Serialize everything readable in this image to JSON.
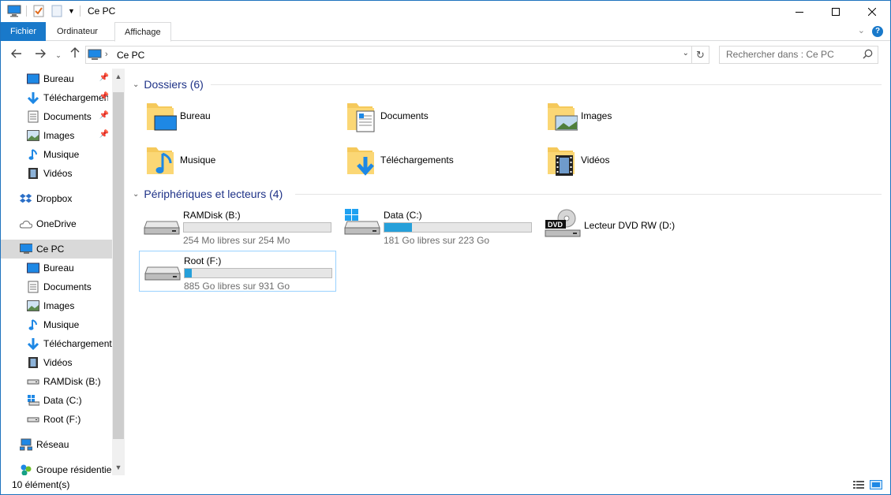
{
  "window": {
    "title": "Ce PC"
  },
  "ribbon": {
    "tabs": [
      "Fichier",
      "Ordinateur",
      "Affichage"
    ],
    "help_label": "?"
  },
  "address": {
    "crumb": "Ce PC",
    "search_placeholder": "Rechercher dans : Ce PC"
  },
  "nav": {
    "quick_access": [
      {
        "label": "Bureau",
        "icon": "desktop-icon",
        "pinned": true
      },
      {
        "label": "Téléchargements",
        "icon": "download-icon",
        "pinned": true
      },
      {
        "label": "Documents",
        "icon": "document-icon",
        "pinned": true
      },
      {
        "label": "Images",
        "icon": "image-icon",
        "pinned": true
      },
      {
        "label": "Musique",
        "icon": "music-icon",
        "pinned": false
      },
      {
        "label": "Vidéos",
        "icon": "video-icon",
        "pinned": false
      }
    ],
    "dropbox": "Dropbox",
    "onedrive": "OneDrive",
    "this_pc": "Ce PC",
    "this_pc_children": [
      {
        "label": "Bureau",
        "icon": "desktop-icon"
      },
      {
        "label": "Documents",
        "icon": "document-icon"
      },
      {
        "label": "Images",
        "icon": "image-icon"
      },
      {
        "label": "Musique",
        "icon": "music-icon"
      },
      {
        "label": "Téléchargements",
        "icon": "download-icon"
      },
      {
        "label": "Vidéos",
        "icon": "video-icon"
      },
      {
        "label": "RAMDisk (B:)",
        "icon": "drive-icon"
      },
      {
        "label": "Data (C:)",
        "icon": "windows-drive-icon"
      },
      {
        "label": "Root (F:)",
        "icon": "drive-icon"
      }
    ],
    "network": "Réseau",
    "homegroup": "Groupe résidentiel"
  },
  "content": {
    "folders_header": "Dossiers (6)",
    "folders": [
      {
        "label": "Bureau",
        "icon": "desktop-folder-icon"
      },
      {
        "label": "Documents",
        "icon": "documents-folder-icon"
      },
      {
        "label": "Images",
        "icon": "pictures-folder-icon"
      },
      {
        "label": "Musique",
        "icon": "music-folder-icon"
      },
      {
        "label": "Téléchargements",
        "icon": "downloads-folder-icon"
      },
      {
        "label": "Vidéos",
        "icon": "videos-folder-icon"
      }
    ],
    "devices_header": "Périphériques et lecteurs (4)",
    "drives": [
      {
        "name": "RAMDisk (B:)",
        "free": "254 Mo libres sur 254 Mo",
        "used_fraction": 0.0,
        "icon": "hdd-icon"
      },
      {
        "name": "Data (C:)",
        "free": "181 Go libres sur 223 Go",
        "used_fraction": 0.19,
        "icon": "windows-hdd-icon"
      },
      {
        "name": "Lecteur DVD RW (D:)",
        "icon": "dvd-drive-icon"
      },
      {
        "name": "Root (F:)",
        "free": "885 Go libres sur 931 Go",
        "used_fraction": 0.05,
        "icon": "hdd-icon"
      }
    ]
  },
  "status": {
    "count": "10 élément(s)"
  },
  "colors": {
    "accent": "#1979ca",
    "header": "#1e3287",
    "bar_fill": "#26a0da",
    "selection": "#d9d9d9"
  }
}
